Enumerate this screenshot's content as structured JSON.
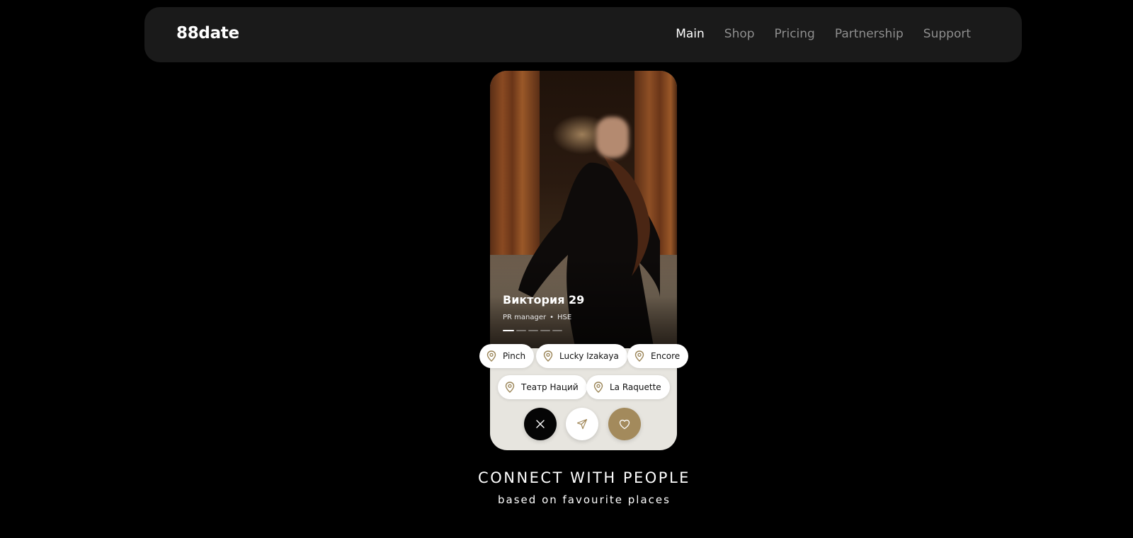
{
  "header": {
    "logo": "88date",
    "nav": [
      {
        "label": "Main",
        "active": true
      },
      {
        "label": "Shop",
        "active": false
      },
      {
        "label": "Pricing",
        "active": false
      },
      {
        "label": "Partnership",
        "active": false
      },
      {
        "label": "Support",
        "active": false
      }
    ]
  },
  "profile": {
    "name": "Виктория",
    "age": "29",
    "job": "PR manager",
    "school": "HSE",
    "photo_count": 5,
    "current_photo": 1
  },
  "places": [
    {
      "label": "Pinch",
      "icon": "location-pin-icon"
    },
    {
      "label": "Lucky Izakaya",
      "icon": "location-pin-icon"
    },
    {
      "label": "Encore",
      "icon": "location-pin-icon"
    },
    {
      "label": "Театр Наций",
      "icon": "location-pin-icon"
    },
    {
      "label": "La Raquette",
      "icon": "location-pin-icon"
    }
  ],
  "actions": [
    {
      "name": "dismiss",
      "icon": "close-icon"
    },
    {
      "name": "send",
      "icon": "send-icon"
    },
    {
      "name": "like",
      "icon": "heart-icon"
    }
  ],
  "hero": {
    "headline": "CONNECT WITH PEOPLE",
    "subline": "based on favourite places"
  },
  "colors": {
    "background": "#000000",
    "navbar": "#1a1a1a",
    "card": "#e7e5df",
    "accent_gold": "#a38a5c",
    "nav_inactive": "#8e8e8e"
  }
}
